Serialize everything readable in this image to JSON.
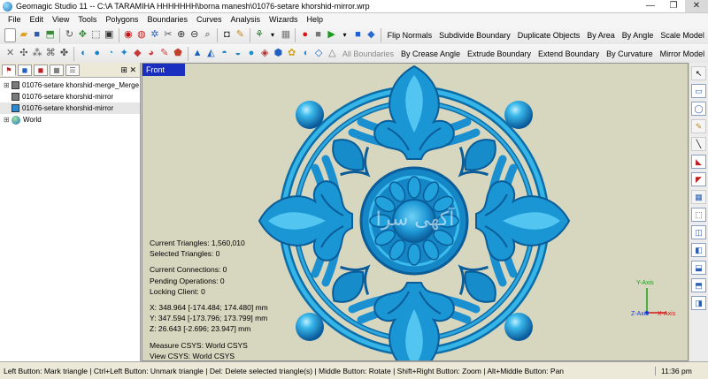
{
  "window": {
    "title": "Geomagic Studio 11 -- C:\\A TARAMIHA HHHHHHH\\borna manesh\\01076-setare khorshid-mirror.wrp",
    "minimize": "—",
    "maximize": "❐",
    "close": "✕"
  },
  "menu": [
    "File",
    "Edit",
    "View",
    "Tools",
    "Polygons",
    "Boundaries",
    "Curves",
    "Analysis",
    "Wizards",
    "Help"
  ],
  "toolbar1": {
    "commands": [
      "Flip Normals",
      "Subdivide Boundary",
      "Duplicate Objects",
      "By Area",
      "By Angle",
      "Scale Model"
    ]
  },
  "toolbar2": {
    "disabled_command": "All Boundaries",
    "commands": [
      "By Crease Angle",
      "Extrude Boundary",
      "Extend Boundary",
      "By Curvature",
      "Mirror Model"
    ]
  },
  "model_tree": {
    "items": [
      {
        "label": "01076-setare khorshid-merge_Merge",
        "icon": "mesh-icon"
      },
      {
        "label": "01076-setare khorshid-mirror",
        "icon": "mesh-icon"
      },
      {
        "label": "01076-setare khorshid-mirror",
        "icon": "mesh-icon"
      },
      {
        "label": "World",
        "icon": "globe-icon"
      }
    ]
  },
  "viewport": {
    "view_name": "Front",
    "current_triangles": "Current Triangles: 1,560,010",
    "selected_triangles": "Selected Triangles: 0",
    "current_connections": "Current Connections: 0",
    "pending_operations": "Pending Operations: 0",
    "locking_client": "Locking Client: 0",
    "x_coord": "X: 348.964 [-174.484; 174.480] mm",
    "y_coord": "Y: 347.594 [-173.796; 173.799] mm",
    "z_coord": "Z: 26.643 [-2.696; 23.947] mm",
    "measure_csys": "Measure CSYS: World CSYS",
    "view_csys": "View CSYS: World CSYS",
    "watermark": "آکهی سرا",
    "axis_y": "Y-Axis",
    "axis_z": "Z-Axis",
    "axis_x": "X-Axis",
    "model_color": "#1a9fd8"
  },
  "statusbar": {
    "hint": "Left Button: Mark triangle | Ctrl+Left Button: Unmark triangle | Del: Delete selected triangle(s) | Middle Button: Rotate | Shift+Right Button: Zoom | Alt+Middle Button: Pan",
    "time": "11:36 pm"
  }
}
